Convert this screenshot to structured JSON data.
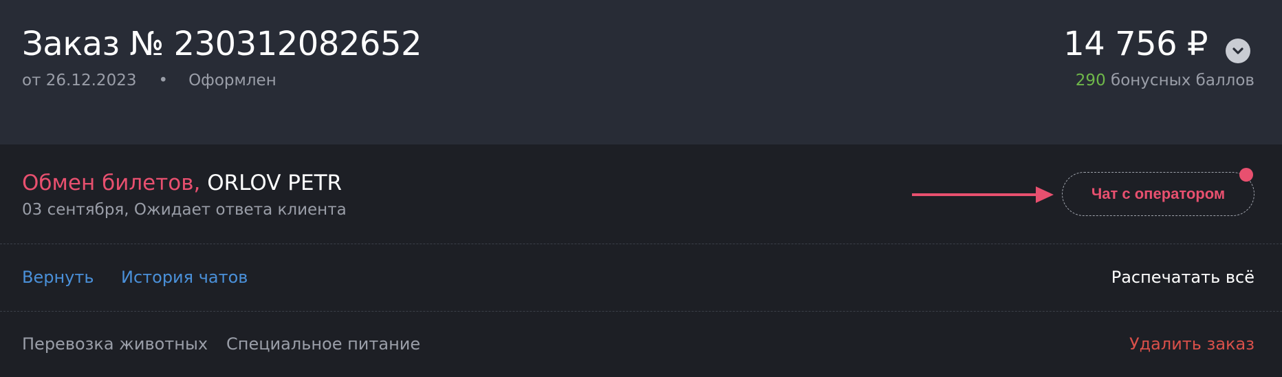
{
  "order": {
    "title": "Заказ № 230312082652",
    "date": "от 26.12.2023",
    "separator": "•",
    "status": "Оформлен",
    "price": "14 756 ₽",
    "bonus_points": "290",
    "bonus_label": "бонусных баллов",
    "toggle_icon": "chevron-down-icon"
  },
  "exchange": {
    "type": "Обмен билетов,",
    "passenger": "ORLOV PETR",
    "subtitle": "03 сентября, Ожидает ответа клиента",
    "chat_button": "Чат с оператором",
    "has_notification": true
  },
  "actions": {
    "return": "Вернуть",
    "chat_history": "История чатов",
    "print_all": "Распечатать всё"
  },
  "services": {
    "pets": "Перевозка животных",
    "special_meal": "Специальное питание",
    "delete_order": "Удалить заказ"
  },
  "colors": {
    "accent_pink": "#e8506f",
    "link_blue": "#4a90d9",
    "bonus_green": "#6fb84a",
    "danger_red": "#d9504a"
  }
}
